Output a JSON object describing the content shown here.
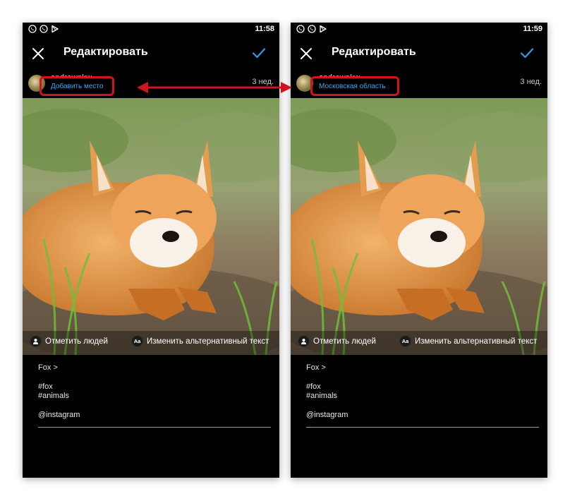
{
  "screens": [
    {
      "time": "11:58",
      "title": "Редактировать",
      "username": "andrewpkw",
      "location_text": "Добавить место",
      "time_ago": "3 нед.",
      "tag_people": "Отметить людей",
      "alt_text": "Изменить альтернативный текст",
      "alt_icon_label": "Aa",
      "caption_lines": [
        "Fox >",
        "#fox",
        "#animals",
        "@instagram"
      ]
    },
    {
      "time": "11:59",
      "title": "Редактировать",
      "username": "andrewpkw",
      "location_text": "Московская область",
      "time_ago": "3 нед.",
      "tag_people": "Отметить людей",
      "alt_text": "Изменить альтернативный текст",
      "alt_icon_label": "Aa",
      "caption_lines": [
        "Fox >",
        "#fox",
        "#animals",
        "@instagram"
      ]
    }
  ],
  "colors": {
    "background": "#000000",
    "accent_blue": "#3897f0",
    "link_blue": "#4aa3e6",
    "annotation_red": "#d0141e"
  },
  "icons": [
    "viber-icon",
    "phone-call-icon",
    "play-store-icon",
    "close-icon",
    "checkmark-icon",
    "person-icon",
    "alt-text-icon",
    "double-arrow-icon"
  ]
}
